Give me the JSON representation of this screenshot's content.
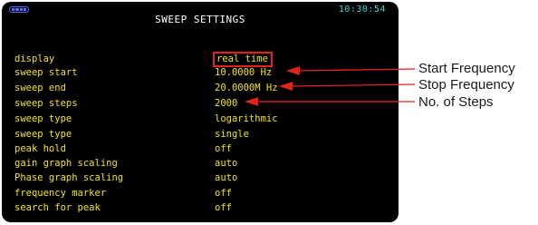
{
  "device": {
    "time": "10:30:54",
    "title": "SWEEP SETTINGS",
    "battery_level": 1.0
  },
  "settings": [
    {
      "label": "display",
      "value": "real time"
    },
    {
      "label": "sweep start",
      "value": "10.0000 Hz"
    },
    {
      "label": "sweep end",
      "value": "20.0000M Hz"
    },
    {
      "label": "sweep steps",
      "value": "2000"
    },
    {
      "label": "sweep type",
      "value": "logarithmic"
    },
    {
      "label": "sweep type",
      "value": "single"
    },
    {
      "label": "peak hold",
      "value": "off"
    },
    {
      "label": "gain graph scaling",
      "value": "auto"
    },
    {
      "label": "Phase graph scaling",
      "value": "auto"
    },
    {
      "label": "frequency marker",
      "value": "off"
    },
    {
      "label": "search for peak",
      "value": "off"
    }
  ],
  "annotations": {
    "start": "Start Frequency",
    "stop": "Stop Frequency",
    "steps": "No. of Steps"
  },
  "colors": {
    "screen_background": "#000000",
    "setting_text": "#f2e21a",
    "title_text": "#ffffff",
    "time_text": "#35d6d6",
    "selection_border": "#e2231a",
    "arrow": "#e2231a",
    "battery": "#4b6cff"
  }
}
